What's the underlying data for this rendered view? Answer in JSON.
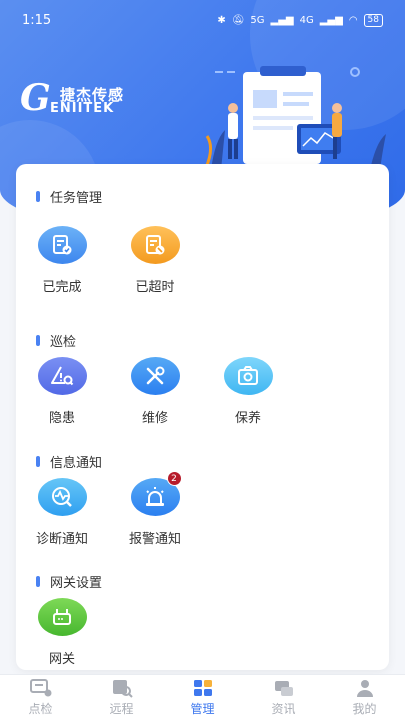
{
  "status_bar": {
    "time": "1:15",
    "network": "5G",
    "network2": "4G",
    "battery": "58"
  },
  "brand": {
    "letter": "G",
    "name_cn": "捷杰传感",
    "name_en": "ENIITEK"
  },
  "sections": [
    {
      "title": "任务管理",
      "items": [
        {
          "label": "已完成",
          "icon": "check-document-icon"
        },
        {
          "label": "已超时",
          "icon": "timeout-document-icon"
        }
      ]
    },
    {
      "title": "巡检",
      "items": [
        {
          "label": "隐患",
          "icon": "warning-search-icon"
        },
        {
          "label": "维修",
          "icon": "wrench-screwdriver-icon"
        },
        {
          "label": "保养",
          "icon": "camera-icon"
        }
      ]
    },
    {
      "title": "信息通知",
      "items": [
        {
          "label": "诊断通知",
          "icon": "diagnosis-wave-icon"
        },
        {
          "label": "报警通知",
          "icon": "alarm-light-icon",
          "badge": "2"
        }
      ]
    },
    {
      "title": "网关设置",
      "items": [
        {
          "label": "网关",
          "icon": "router-icon"
        }
      ]
    }
  ],
  "tabbar": [
    {
      "label": "点检",
      "icon": "inspection-tab-icon",
      "active": false
    },
    {
      "label": "远程",
      "icon": "remote-tab-icon",
      "active": false
    },
    {
      "label": "管理",
      "icon": "management-tab-icon",
      "active": true
    },
    {
      "label": "资讯",
      "icon": "news-tab-icon",
      "active": false
    },
    {
      "label": "我的",
      "icon": "profile-tab-icon",
      "active": false
    }
  ],
  "colors": {
    "primary": "#3f78ee",
    "badge": "#b71c2b",
    "tab_inactive": "#a9adb5"
  }
}
